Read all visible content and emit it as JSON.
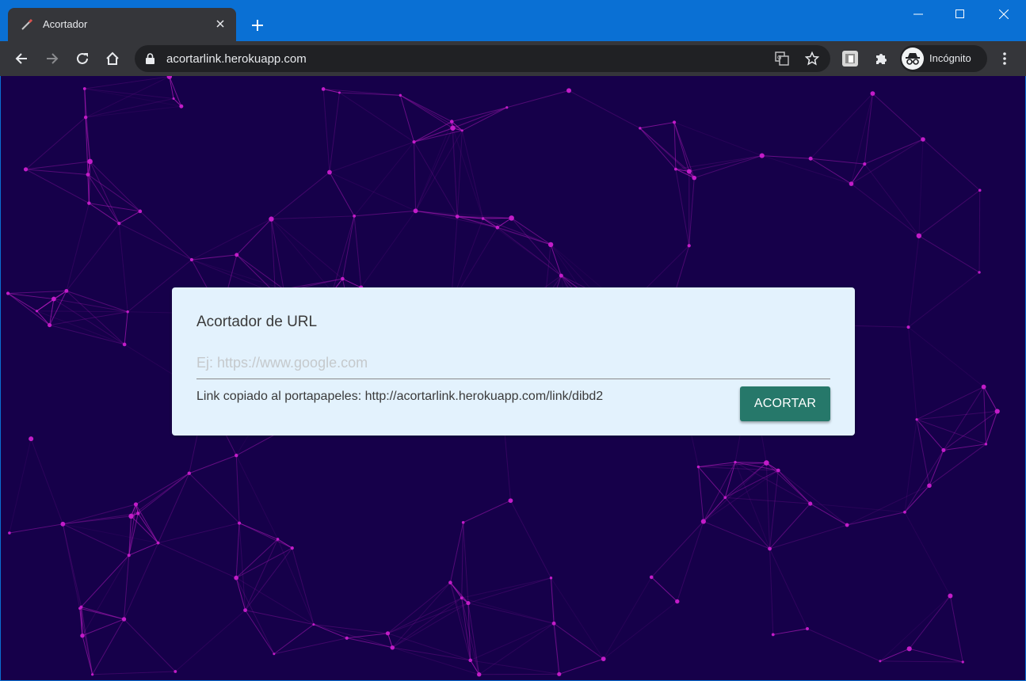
{
  "browser": {
    "tab_title": "Acortador",
    "url": "acortarlink.herokuapp.com",
    "profile_label": "Incógnito"
  },
  "page": {
    "title": "Acortador de URL",
    "input": {
      "placeholder": "Ej: https://www.google.com",
      "value": ""
    },
    "status": "Link copiado al portapapeles: http://acortarlink.herokuapp.com/link/dibd2",
    "button_label": "ACORTAR"
  },
  "colors": {
    "titlebar": "#0a70d4",
    "toolbar": "#35363a",
    "page_bg": "#16004a",
    "network_lines": "#c21cc8",
    "card_bg": "#e3f2fd",
    "button": "#26786a"
  },
  "icons": [
    "tab-favicon-icon",
    "close-icon",
    "plus-icon",
    "minimize-icon",
    "maximize-icon",
    "window-close-icon",
    "back-icon",
    "forward-icon",
    "reload-icon",
    "home-icon",
    "lock-icon",
    "translate-icon",
    "star-icon",
    "extension-app-icon",
    "puzzle-icon",
    "incognito-icon",
    "more-vert-icon"
  ]
}
